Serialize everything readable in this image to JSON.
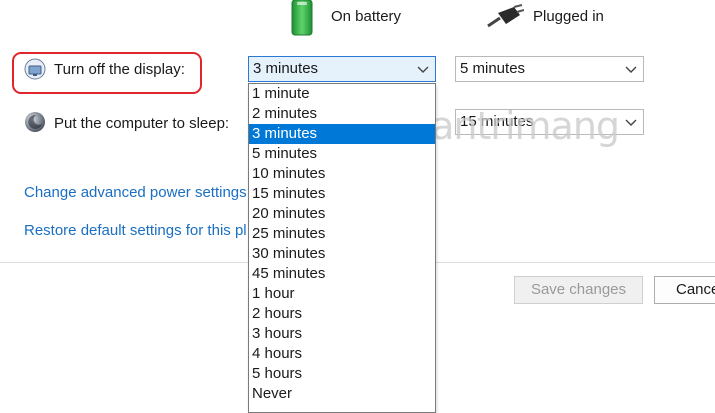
{
  "columns": {
    "battery_label": "On battery",
    "plugged_label": "Plugged in"
  },
  "rows": {
    "display": {
      "label": "Turn off the display:",
      "battery_value": "3 minutes",
      "plugged_value": "5 minutes"
    },
    "sleep": {
      "label": "Put the computer to sleep:",
      "plugged_value": "15 minutes"
    }
  },
  "links": {
    "advanced": "Change advanced power settings",
    "restore": "Restore default settings for this pl"
  },
  "dropdown": {
    "options": [
      "1 minute",
      "2 minutes",
      "3 minutes",
      "5 minutes",
      "10 minutes",
      "15 minutes",
      "20 minutes",
      "25 minutes",
      "30 minutes",
      "45 minutes",
      "1 hour",
      "2 hours",
      "3 hours",
      "4 hours",
      "5 hours",
      "Never"
    ],
    "selected_index": 2
  },
  "buttons": {
    "save": "Save changes",
    "cancel": "Cance"
  },
  "watermark": "uantrimang",
  "colors": {
    "accent": "#0078d7",
    "link": "#1a6fc2",
    "highlight": "#e0262b",
    "battery_green": "#2fb344"
  },
  "icons": [
    "battery-icon",
    "plug-icon",
    "display-icon",
    "sleep-icon",
    "chevron-down-icon",
    "lightbulb-icon"
  ]
}
